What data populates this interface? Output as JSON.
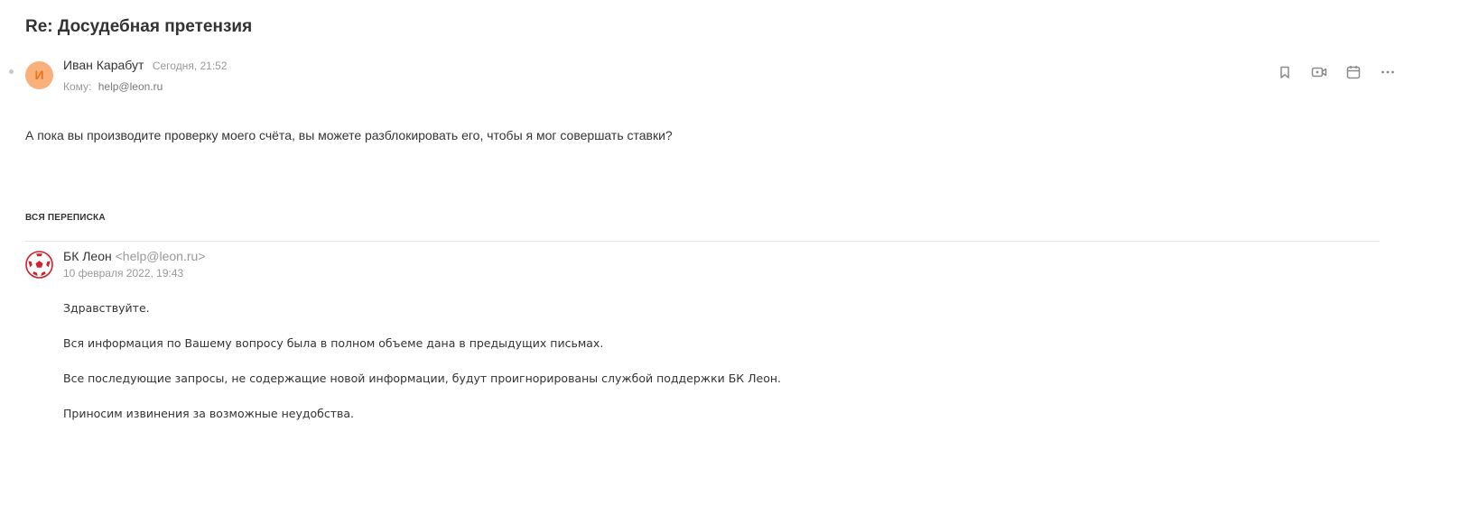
{
  "email": {
    "subject": "Re: Досудебная претензия",
    "sender": {
      "initial": "И",
      "name": "Иван Карабут",
      "date": "Сегодня, 21:52"
    },
    "recipient": {
      "label": "Кому:",
      "value": "help@leon.ru"
    },
    "body": "А пока вы производите проверку моего счёта, вы можете разблокировать его, чтобы я мог совершать ставки?"
  },
  "toolbar": {
    "icons": [
      "bookmark-icon",
      "video-icon",
      "calendar-icon",
      "more-icon"
    ]
  },
  "thread": {
    "heading": "ВСЯ ПЕРЕПИСКА",
    "messages": [
      {
        "sender_name": "БК Леон",
        "sender_email": "<help@leon.ru>",
        "date": "10 февраля 2022, 19:43",
        "paragraphs": [
          "Здравствуйте.",
          "Вся информация по Вашему вопросу была в полном объеме дана в предыдущих письмах.",
          "Все последующие запросы, не содержащие новой информации, будут проигнорированы службой поддержки БК Леон.",
          "Приносим извинения за возможные неудобства."
        ]
      }
    ]
  },
  "colors": {
    "avatar_bg": "#f9b07a",
    "avatar_text": "#e8751e",
    "logo_red": "#d0202e",
    "muted_text": "#999999"
  }
}
